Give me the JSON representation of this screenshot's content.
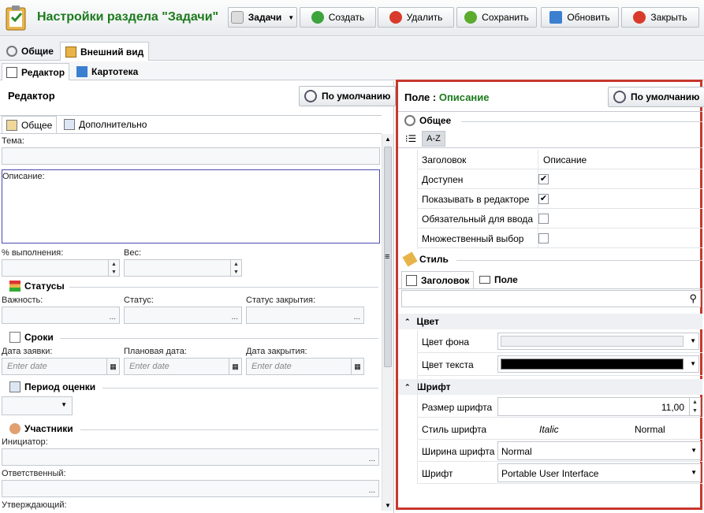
{
  "window": {
    "title": "Настройки раздела \"Задачи\""
  },
  "toolbar": {
    "section_label": "Задачи",
    "create": "Создать",
    "delete": "Удалить",
    "save": "Сохранить",
    "refresh": "Обновить",
    "close": "Закрыть"
  },
  "tabs_main": [
    "Общие",
    "Внешний вид"
  ],
  "tabs_sub": [
    "Редактор",
    "Картотека"
  ],
  "editor": {
    "title": "Редактор",
    "default_button": "По умолчанию",
    "tabs": [
      "Общее",
      "Дополнительно"
    ],
    "fields": {
      "subject": "Тема:",
      "description": "Описание:",
      "percent": "% выполнения:",
      "weight": "Вес:",
      "importance": "Важность:",
      "status": "Статус:",
      "close_status": "Статус закрытия:",
      "request_date": "Дата заявки:",
      "plan_date": "Плановая дата:",
      "close_date": "Дата закрытия:",
      "initiator": "Инициатор:",
      "responsible": "Ответственный:",
      "approver": "Утверждающий:"
    },
    "sections": {
      "statuses": "Статусы",
      "terms": "Сроки",
      "period": "Период оценки",
      "participants": "Участники"
    },
    "date_placeholder": "Enter date",
    "ellipsis": "..."
  },
  "field_props": {
    "title_prefix": "Поле :",
    "field_name": "Описание",
    "default_button": "По умолчанию",
    "general_section": "Общее",
    "sort_az": "A-Z",
    "properties": [
      {
        "name": "Заголовок",
        "value": "Описание",
        "type": "text"
      },
      {
        "name": "Доступен",
        "checked": true,
        "type": "check"
      },
      {
        "name": "Показывать в редакторе",
        "checked": true,
        "type": "check"
      },
      {
        "name": "Обязательный для ввода",
        "checked": false,
        "type": "check"
      },
      {
        "name": "Множественный выбор",
        "checked": false,
        "type": "check"
      }
    ],
    "style_section": "Стиль",
    "style_tabs": [
      "Заголовок",
      "Поле"
    ],
    "color_group": "Цвет",
    "bg_color_label": "Цвет фона",
    "text_color_label": "Цвет текста",
    "text_color_value": "#000000",
    "font_group": "Шрифт",
    "font_size_label": "Размер шрифта",
    "font_size_value": "11,00",
    "font_style_label": "Стиль шрифта",
    "font_style_italic": "Italic",
    "font_style_normal": "Normal",
    "font_weight_label": "Ширина шрифта",
    "font_weight_value": "Normal",
    "font_label": "Шрифт",
    "font_value": "Portable User Interface"
  },
  "colors": {
    "accent_green": "#1d7a1d",
    "highlight_red": "#c8372d"
  }
}
